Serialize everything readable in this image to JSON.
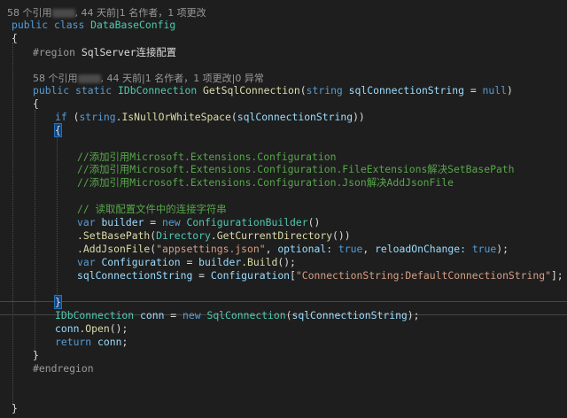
{
  "codelens": {
    "class_refs": "58 个引用",
    "class_after": ", 44 天前|1 名作者，1 项更改",
    "method_refs": "58 个引用",
    "method_after": ", 44 天前|1 名作者，1 项更改|0 异常"
  },
  "code": {
    "l_public": "public",
    "l_class": "class",
    "class_name": "DataBaseConfig",
    "open_brace": "{",
    "close_brace": "}",
    "region_start": "#region",
    "region_name": "SqlServer连接配置",
    "static": "static",
    "idb_type": "IDbConnection",
    "method_name": "GetSqlConnection",
    "param_open": "(",
    "string_kw": "string",
    "param_name": "sqlConnectionString",
    "equals": " = ",
    "null_kw": "null",
    "param_close": ")",
    "if_kw": "if",
    "if_open": " (",
    "is_null_method": ".IsNullOrWhiteSpace",
    "if_inner_open": "(",
    "if_close": "))",
    "comment1": "//添加引用Microsoft.Extensions.Configuration",
    "comment2": "//添加引用Microsoft.Extensions.Configuration.FileExtensions解决SetBasePath",
    "comment3": "//添加引用Microsoft.Extensions.Configuration.Json解决AddJsonFile",
    "comment4": "// 读取配置文件中的连接字符串",
    "var_kw": "var",
    "builder_var": "builder",
    "new_kw": "new",
    "config_builder": "ConfigurationBuilder",
    "empty_parens": "()",
    "set_base_path": ".SetBasePath",
    "directory_type": "Directory",
    "get_current_dir": ".GetCurrentDirectory",
    "double_close": "())",
    "add_json_file": ".AddJsonFile",
    "json_str": "\"appsettings.json\"",
    "optional_label": "optional:",
    "true_kw": "true",
    "reload_label": "reloadOnChange:",
    "end_call": ");",
    "configuration_var": "Configuration",
    "build_method": ".Build",
    "build_end": "();",
    "assign_target": "sqlConnectionString",
    "index_open": "[",
    "conn_key_str": "\"ConnectionString:DefaultConnectionString\"",
    "index_close": "];",
    "conn_var": "conn",
    "sql_conn_type": "SqlConnection",
    "open_method": ".Open",
    "return_kw": "return",
    "return_end": ";",
    "region_end": "#endregion",
    "comma": ", ",
    "lparen": "(",
    "rparen_semi": ");"
  }
}
